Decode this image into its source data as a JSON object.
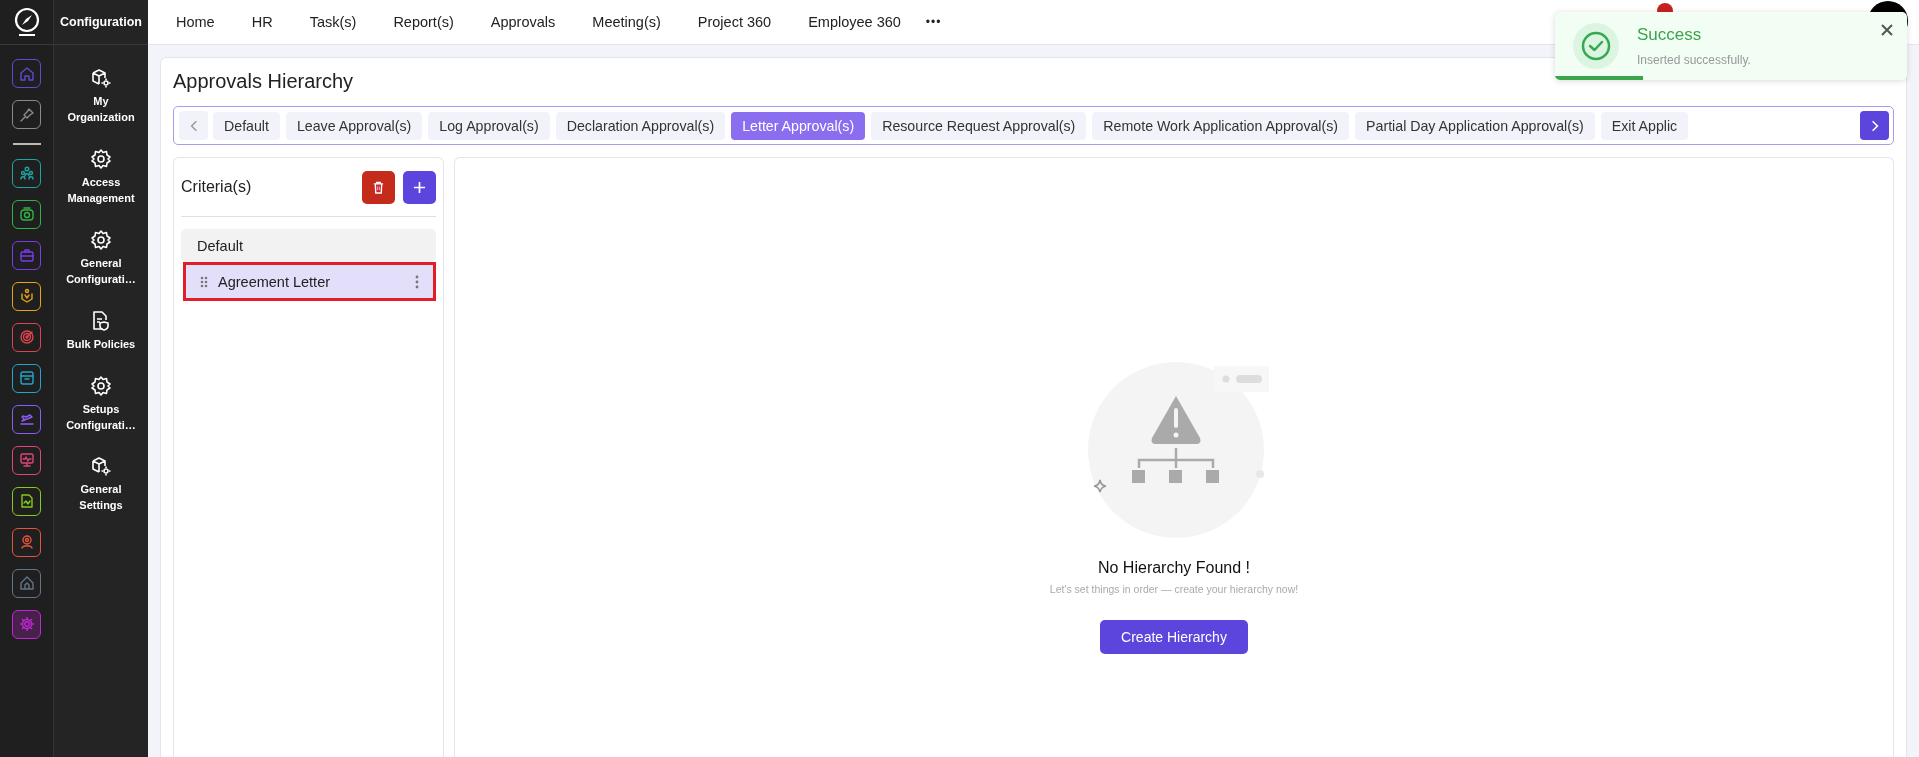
{
  "rail": {
    "items": [
      {
        "kind": "home",
        "color": "#5b4bd6",
        "selected": false
      },
      {
        "kind": "pin",
        "color": "#8a8a8a",
        "selected": false
      },
      {
        "kind": "people",
        "color": "#1fa3a3",
        "selected": false
      },
      {
        "kind": "robot",
        "color": "#2fb344",
        "selected": false
      },
      {
        "kind": "briefcase",
        "color": "#7c3aed",
        "selected": false
      },
      {
        "kind": "hands",
        "color": "#e8a317",
        "selected": false
      },
      {
        "kind": "target",
        "color": "#e0434f",
        "selected": false
      },
      {
        "kind": "archive",
        "color": "#22a5c9",
        "selected": false
      },
      {
        "kind": "plane",
        "color": "#8b5cf6",
        "selected": false
      },
      {
        "kind": "monitor",
        "color": "#e0457b",
        "selected": false
      },
      {
        "kind": "document",
        "color": "#84cc16",
        "selected": false
      },
      {
        "kind": "person",
        "color": "#e5533d",
        "selected": false
      },
      {
        "kind": "house",
        "color": "#64748b",
        "selected": false
      },
      {
        "kind": "gear",
        "color": "#c026d3",
        "selected": true
      }
    ]
  },
  "sidebar": {
    "title": "Configuration",
    "items": [
      {
        "kind": "cube-gear",
        "label": "My Organization"
      },
      {
        "kind": "gear",
        "label": "Access Management"
      },
      {
        "kind": "gear",
        "label": "General Configurati…"
      },
      {
        "kind": "doc-shield",
        "label": "Bulk Policies"
      },
      {
        "kind": "gear",
        "label": "Setups Configurati…"
      },
      {
        "kind": "cube-gear",
        "label": "General Settings"
      }
    ]
  },
  "nav": {
    "items": [
      "Home",
      "HR",
      "Task(s)",
      "Report(s)",
      "Approvals",
      "Meeting(s)",
      "Project 360",
      "Employee 360"
    ],
    "more": "•••"
  },
  "page": {
    "title": "Approvals Hierarchy",
    "tabs": [
      {
        "label": "Default",
        "selected": false
      },
      {
        "label": "Leave Approval(s)",
        "selected": false
      },
      {
        "label": "Log Approval(s)",
        "selected": false
      },
      {
        "label": "Declaration Approval(s)",
        "selected": false
      },
      {
        "label": "Letter Approval(s)",
        "selected": true
      },
      {
        "label": "Resource Request Approval(s)",
        "selected": false
      },
      {
        "label": "Remote Work Application Approval(s)",
        "selected": false
      },
      {
        "label": "Partial Day Application Approval(s)",
        "selected": false
      },
      {
        "label": "Exit Applic",
        "selected": false
      }
    ]
  },
  "criteria": {
    "title": "Criteria(s)",
    "items": [
      {
        "kind": "default",
        "label": "Default",
        "selected": false,
        "highlighted": false
      },
      {
        "kind": "draggable",
        "label": "Agreement Letter",
        "selected": true,
        "highlighted": true
      }
    ]
  },
  "empty_state": {
    "title": "No Hierarchy Found !",
    "message": "Let's set things in order — create your hierarchy now!",
    "button": "Create Hierarchy"
  },
  "toast": {
    "title": "Success",
    "message": "Inserted successfully.",
    "level": 0.25
  }
}
